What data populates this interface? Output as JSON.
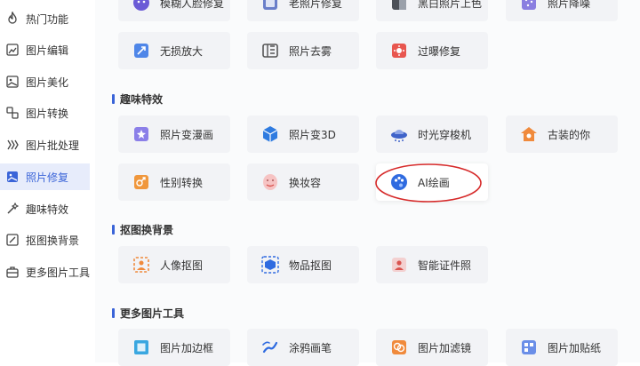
{
  "sidebar": {
    "items": [
      {
        "label": "热门功能"
      },
      {
        "label": "图片编辑"
      },
      {
        "label": "图片美化"
      },
      {
        "label": "图片转换"
      },
      {
        "label": "图片批处理"
      },
      {
        "label": "照片修复"
      },
      {
        "label": "趣味特效"
      },
      {
        "label": "抠图换背景"
      },
      {
        "label": "更多图片工具"
      }
    ],
    "active_index": 5
  },
  "main": {
    "top_row": [
      "模糊人脸修复",
      "老照片修复",
      "黑白照片上色",
      "照片降噪"
    ],
    "repair_row2": [
      "无损放大",
      "照片去雾",
      "过曝修复"
    ],
    "sections": {
      "fun": {
        "title": "趣味特效"
      },
      "matting": {
        "title": "抠图换背景"
      },
      "more": {
        "title": "更多图片工具"
      }
    },
    "fun_row1": [
      "照片变漫画",
      "照片变3D",
      "时光穿梭机",
      "古装的你"
    ],
    "fun_row2": [
      "性别转换",
      "换妆容",
      "AI绘画"
    ],
    "matting_row": [
      "人像抠图",
      "物品抠图",
      "智能证件照"
    ],
    "more_row": [
      "图片加边框",
      "涂鸦画笔",
      "图片加滤镜",
      "图片加贴纸"
    ]
  },
  "colors": {
    "accent": "#3a64d8",
    "annotation": "#d62a2a"
  }
}
